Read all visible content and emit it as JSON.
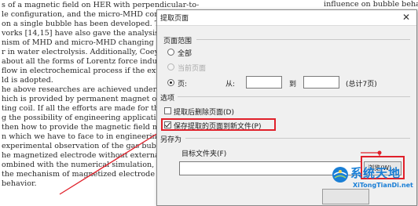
{
  "document": {
    "top_right": "influence on bubble behavior has been introduced in previous",
    "lines": [
      "s of a magnetic field on HER with perpendicular-to-",
      "le configuration, and the micro-MHD convection",
      "on a single bubble has been developed. The auth",
      "vorks [14,15] have also gave the analysis about",
      "nism of MHD and micro-MHD changing bu",
      "r in water electrolysis. Additionally, Coey [16] ga",
      "about all the forms of Lorentz force induced hydr",
      "flow in electrochemical process if the external",
      "ld is adopted.",
      "he above researches are achieved under the exte",
      "hich is provided by permanent magnet or su",
      "ting coil. If all the efforts are made for the purpo",
      "g the possibility of engineering application in",
      "then how to provide the magnetic field may be the",
      "n which we have to face to in engineering. This",
      "experimental observation of the gas bubble evolu",
      "he magnetized electrode without external mag",
      "ombined with the numerical simulation, the ana",
      "the mechanism of magnetized electrode chan",
      "behavior."
    ]
  },
  "dialog": {
    "title": "提取页面",
    "close_glyph": "✕",
    "page_range": {
      "group_label": "页面范围",
      "all_label": "全部",
      "current_label": "当前页面",
      "pages_label": "页:",
      "from_label": "从:",
      "to_label": "到",
      "total_label": "(总计7页)",
      "from_value": "",
      "to_value": ""
    },
    "options": {
      "group_label": "选项",
      "delete_after_label": "提取后删除页面(D)",
      "save_new_file_label": "保存提取的页面到新文件(P)"
    },
    "save_as": {
      "group_label": "另存为",
      "target_folder_label": "目标文件夹(F)",
      "folder_value": "",
      "browse_label": "浏览(W)..."
    }
  },
  "watermark": {
    "text": "系统天地",
    "url": "XiTongTianDi.net"
  },
  "colors": {
    "annotation_red": "#e0202a",
    "watermark_blue": "#1a7fd6"
  }
}
